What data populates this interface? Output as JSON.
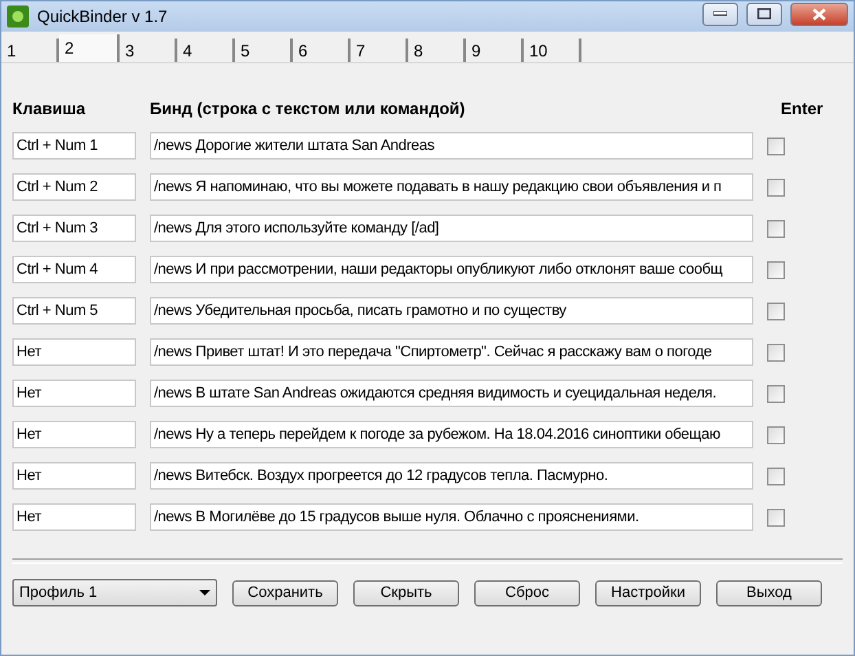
{
  "window": {
    "title": "QuickBinder v 1.7"
  },
  "tabs": [
    {
      "label": "1",
      "selected": false
    },
    {
      "label": "2",
      "selected": true
    },
    {
      "label": "3",
      "selected": false
    },
    {
      "label": "4",
      "selected": false
    },
    {
      "label": "5",
      "selected": false
    },
    {
      "label": "6",
      "selected": false
    },
    {
      "label": "7",
      "selected": false
    },
    {
      "label": "8",
      "selected": false
    },
    {
      "label": "9",
      "selected": false
    },
    {
      "label": "10",
      "selected": false
    }
  ],
  "columns": [
    "Клавиша",
    "Бинд (строка с текстом или командой)",
    "Enter"
  ],
  "rows": [
    {
      "key": "Ctrl + Num 1",
      "bind": "/news Дорогие жители штата San Andreas",
      "enter": false
    },
    {
      "key": "Ctrl + Num 2",
      "bind": "/news Я напоминаю, что вы можете подавать в нашу редакцию свои объявления и п",
      "enter": false
    },
    {
      "key": "Ctrl + Num 3",
      "bind": "/news Для этого используйте команду [/ad]",
      "enter": false
    },
    {
      "key": "Ctrl + Num 4",
      "bind": "/news И при рассмотрении, наши редакторы опубликуют либо отклонят ваше сообщ",
      "enter": false
    },
    {
      "key": "Ctrl + Num 5",
      "bind": "/news Убедительная просьба, писать грамотно и по существу",
      "enter": false
    },
    {
      "key": "Нет",
      "bind": "/news Привет штат! И это передача \"Спиртометр\". Сейчас я расскажу вам о погоде",
      "enter": false
    },
    {
      "key": "Нет",
      "bind": "/news В штате San Andreas ожидаются средняя видимость и суецидальная неделя.",
      "enter": false
    },
    {
      "key": "Нет",
      "bind": "/news Ну а теперь перейдем к погоде за рубежом. На 18.04.2016 синоптики обещаю",
      "enter": false
    },
    {
      "key": "Нет",
      "bind": "/news Витебск. Воздух прогреется до 12 градусов тепла. Пасмурно.",
      "enter": false
    },
    {
      "key": "Нет",
      "bind": "/news В Могилёве до 15 градусов выше нуля. Облачно с прояснениями.",
      "enter": false
    }
  ],
  "profile": "Профиль 1",
  "buttons": [
    "Сохранить",
    "Скрыть",
    "Сброс",
    "Настройки",
    "Выход"
  ]
}
